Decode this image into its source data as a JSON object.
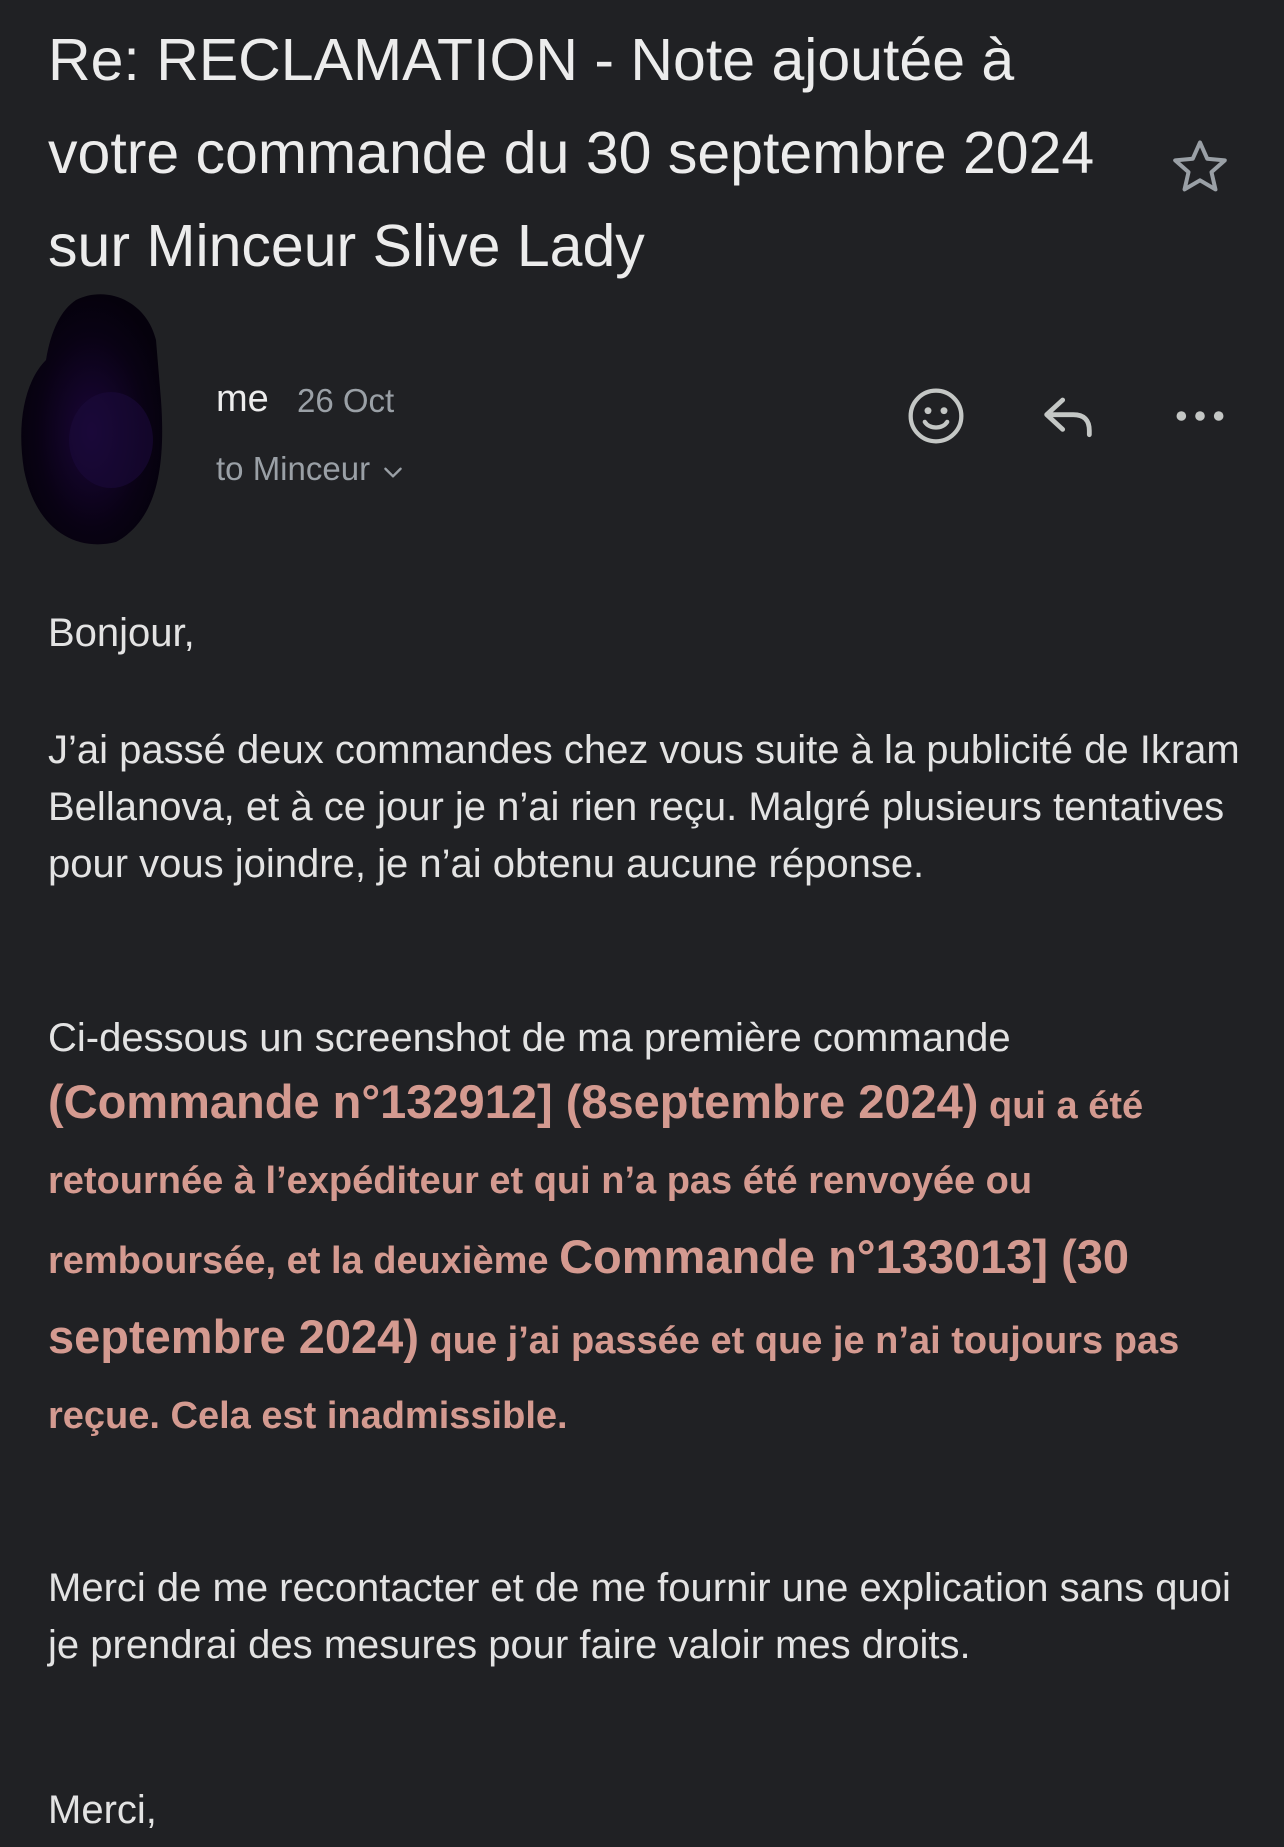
{
  "email": {
    "subject": "Re: RECLAMATION - Note ajoutée à votre commande du 30 septembre 2024 sur Minceur Slive Lady",
    "starred": false,
    "sender": {
      "name": "me",
      "date": "26 Oct",
      "recipient": "to Minceur"
    },
    "actions": {
      "react_icon": "smiley-icon",
      "reply_icon": "reply-icon",
      "more_icon": "more-horizontal-icon"
    },
    "body": {
      "greeting": "Bonjour,",
      "paragraph1": "J’ai passé deux commandes chez vous suite à la publicité de Ikram Bellanova, et à ce jour je n’ai rien reçu. Malgré plusieurs tentatives pour vous joindre, je n’ai obtenu aucune réponse.",
      "paragraph2_intro": "Ci-dessous un screenshot de ma première commande",
      "order1": "(Commande n°132912] (8septembre 2024)",
      "text_a": " qui a été retournée à l’expéditeur et qui n’a pas été renvoyée ou remboursée, et la deuxième ",
      "order2": "Commande n°133013] (30 septembre 2024)",
      "text_b": " que j’ai passée et que je n’ai toujours pas reçue. Cela est inadmissible.",
      "paragraph3": "Merci de me recontacter et de me fournir une explication sans quoi je prendrai des mesures pour faire valoir mes droits.",
      "closing": "Merci,"
    },
    "colors": {
      "background": "#202124",
      "highlight": "#d49a90",
      "muted": "#9aa0a6"
    }
  }
}
